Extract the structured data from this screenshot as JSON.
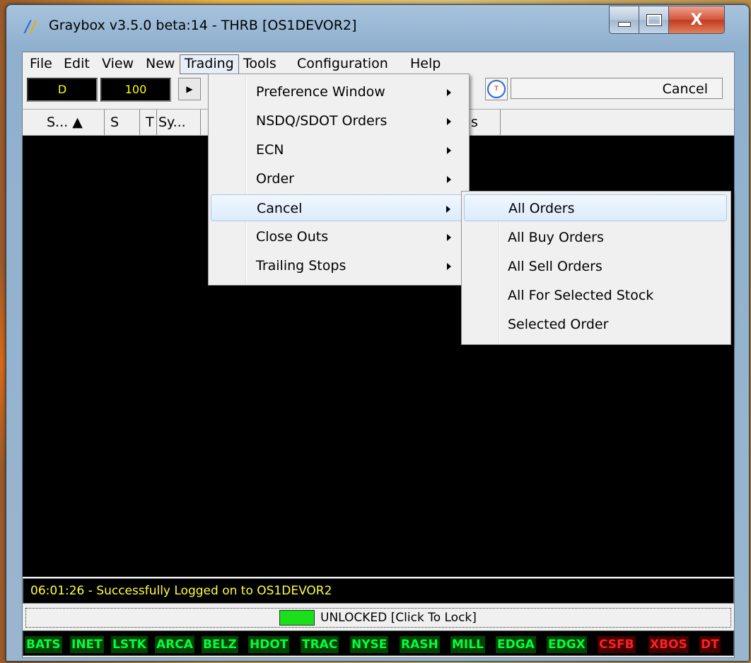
{
  "window": {
    "title": "Graybox v3.5.0 beta:14 - THRB [OS1DEVOR2]",
    "close_glyph": "X"
  },
  "menubar": [
    "File",
    "Edit",
    "View",
    "New",
    "Trading",
    "Tools",
    "Configuration",
    "Help"
  ],
  "menubar_active": "Trading",
  "toolbar": {
    "field1": "D",
    "field2": "100",
    "cancel_label": "Cancel"
  },
  "columns": [
    "S... ▲",
    "S",
    "T",
    "Sy...",
    "s"
  ],
  "trading_menu": [
    {
      "label": "Preference Window"
    },
    {
      "label": "NSDQ/SDOT Orders"
    },
    {
      "label": "ECN"
    },
    {
      "label": "Order"
    },
    {
      "label": "Cancel"
    },
    {
      "label": "Close Outs"
    },
    {
      "label": "Trailing Stops"
    }
  ],
  "trading_menu_highlighted": "Cancel",
  "cancel_submenu": [
    {
      "label": "All Orders"
    },
    {
      "label": "All Buy Orders"
    },
    {
      "label": "All Sell Orders"
    },
    {
      "label": "All For Selected Stock"
    },
    {
      "label": "Selected Order"
    }
  ],
  "cancel_submenu_highlighted": "All Orders",
  "status": {
    "message": "06:01:26 - Successfully Logged on to OS1DEVOR2",
    "lock_text": "UNLOCKED [Click To Lock]"
  },
  "ecns": [
    {
      "name": "BATS",
      "state": "on"
    },
    {
      "name": "INET",
      "state": "on"
    },
    {
      "name": "LSTK",
      "state": "on"
    },
    {
      "name": "ARCA",
      "state": "on"
    },
    {
      "name": "BELZ",
      "state": "on"
    },
    {
      "name": "HDOT",
      "state": "on"
    },
    {
      "name": "TRAC",
      "state": "on"
    },
    {
      "name": "NYSE",
      "state": "on"
    },
    {
      "name": "RASH",
      "state": "on"
    },
    {
      "name": "MILL",
      "state": "on"
    },
    {
      "name": "EDGA",
      "state": "on"
    },
    {
      "name": "EDGX",
      "state": "on"
    },
    {
      "name": "CSFB",
      "state": "off"
    },
    {
      "name": "XBOS",
      "state": "off"
    },
    {
      "name": "DT",
      "state": "off"
    }
  ],
  "colors": {
    "ecn_on": "#00ff40",
    "ecn_off": "#ff2020",
    "status_text": "#ffff40",
    "lock_indicator": "#19e019"
  }
}
